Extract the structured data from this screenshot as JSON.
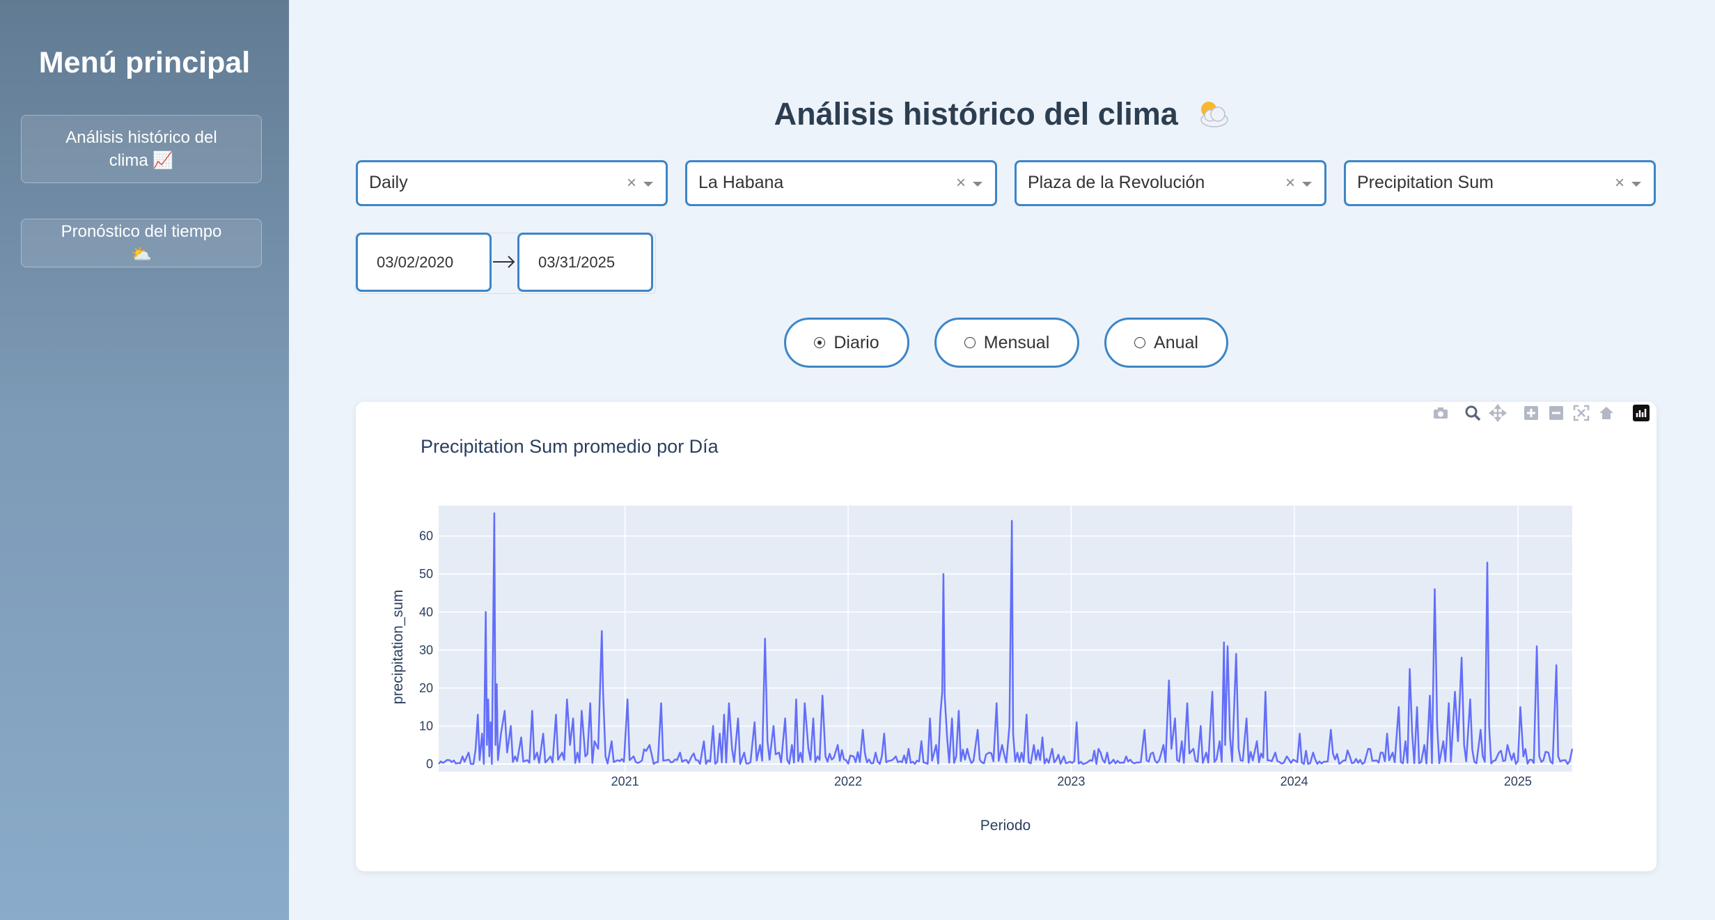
{
  "sidebar": {
    "title": "Menú principal",
    "items": [
      {
        "label": "Análisis histórico del clima",
        "icon": "📈"
      },
      {
        "label": "Pronóstico del tiempo",
        "icon": "⛅"
      }
    ]
  },
  "header": {
    "title": "Análisis histórico del clima",
    "icon": "sun-behind-cloud-icon"
  },
  "filters": {
    "frequency": "Daily",
    "province": "La Habana",
    "municipality": "Plaza de la Revolución",
    "variable": "Precipitation Sum",
    "clear_symbol": "×"
  },
  "date_range": {
    "start": "03/02/2020",
    "end": "03/31/2025"
  },
  "aggregation": {
    "options": [
      "Diario",
      "Mensual",
      "Anual"
    ],
    "selected": "Diario"
  },
  "modebar": [
    "camera-icon",
    "zoom-icon",
    "pan-icon",
    "zoom-in-icon",
    "zoom-out-icon",
    "autoscale-icon",
    "reset-axes-icon",
    "plotly-logo-icon"
  ],
  "colors": {
    "accent": "#3d85c6",
    "series": "#636efa",
    "plot_bg": "#e5ecf6"
  },
  "chart_data": {
    "type": "line",
    "title": "Precipitation Sum promedio por Día",
    "xlabel": "Periodo",
    "ylabel": "precipitation_sum",
    "xlim": [
      "2020-03-02",
      "2025-03-31"
    ],
    "ylim": [
      0,
      68
    ],
    "xticks": [
      "2021",
      "2022",
      "2023",
      "2024",
      "2025"
    ],
    "yticks": [
      0,
      10,
      20,
      30,
      40,
      50,
      60
    ],
    "grid": true,
    "series": [
      {
        "points": [
          [
            "2020-03-02",
            0
          ],
          [
            "2020-03-20",
            1
          ],
          [
            "2020-04-10",
            2
          ],
          [
            "2020-04-20",
            3
          ],
          [
            "2020-04-28",
            0
          ],
          [
            "2020-05-05",
            13
          ],
          [
            "2020-05-08",
            1
          ],
          [
            "2020-05-12",
            8
          ],
          [
            "2020-05-15",
            0
          ],
          [
            "2020-05-18",
            40
          ],
          [
            "2020-05-20",
            5
          ],
          [
            "2020-05-22",
            17
          ],
          [
            "2020-05-24",
            2
          ],
          [
            "2020-05-26",
            11
          ],
          [
            "2020-05-28",
            0
          ],
          [
            "2020-06-01",
            66
          ],
          [
            "2020-06-03",
            5
          ],
          [
            "2020-06-05",
            21
          ],
          [
            "2020-06-07",
            1
          ],
          [
            "2020-06-12",
            8
          ],
          [
            "2020-06-18",
            14
          ],
          [
            "2020-06-22",
            3
          ],
          [
            "2020-06-28",
            10
          ],
          [
            "2020-07-05",
            2
          ],
          [
            "2020-07-15",
            7
          ],
          [
            "2020-07-25",
            1
          ],
          [
            "2020-08-02",
            14
          ],
          [
            "2020-08-10",
            3
          ],
          [
            "2020-08-20",
            8
          ],
          [
            "2020-09-01",
            2
          ],
          [
            "2020-09-10",
            13
          ],
          [
            "2020-09-20",
            3
          ],
          [
            "2020-09-28",
            17
          ],
          [
            "2020-10-03",
            5
          ],
          [
            "2020-10-08",
            12
          ],
          [
            "2020-10-15",
            3
          ],
          [
            "2020-10-22",
            14
          ],
          [
            "2020-10-28",
            2
          ],
          [
            "2020-11-05",
            16
          ],
          [
            "2020-11-12",
            6
          ],
          [
            "2020-11-18",
            4
          ],
          [
            "2020-11-24",
            35
          ],
          [
            "2020-11-26",
            19
          ],
          [
            "2020-11-30",
            2
          ],
          [
            "2020-12-10",
            6
          ],
          [
            "2020-12-20",
            1
          ],
          [
            "2021-01-05",
            17
          ],
          [
            "2021-01-15",
            2
          ],
          [
            "2021-02-10",
            5
          ],
          [
            "2021-03-01",
            16
          ],
          [
            "2021-03-10",
            1
          ],
          [
            "2021-04-01",
            3
          ],
          [
            "2021-04-20",
            2
          ],
          [
            "2021-05-10",
            6
          ],
          [
            "2021-05-25",
            10
          ],
          [
            "2021-06-05",
            8
          ],
          [
            "2021-06-12",
            13
          ],
          [
            "2021-06-20",
            16
          ],
          [
            "2021-06-25",
            4
          ],
          [
            "2021-07-05",
            12
          ],
          [
            "2021-07-15",
            3
          ],
          [
            "2021-08-01",
            11
          ],
          [
            "2021-08-10",
            5
          ],
          [
            "2021-08-18",
            33
          ],
          [
            "2021-08-22",
            6
          ],
          [
            "2021-09-01",
            10
          ],
          [
            "2021-09-10",
            3
          ],
          [
            "2021-09-20",
            12
          ],
          [
            "2021-10-01",
            5
          ],
          [
            "2021-10-08",
            17
          ],
          [
            "2021-10-15",
            3
          ],
          [
            "2021-10-22",
            16
          ],
          [
            "2021-10-28",
            4
          ],
          [
            "2021-11-05",
            12
          ],
          [
            "2021-11-12",
            2
          ],
          [
            "2021-11-20",
            18
          ],
          [
            "2021-11-25",
            2
          ],
          [
            "2021-12-15",
            5
          ],
          [
            "2022-01-10",
            2
          ],
          [
            "2022-01-25",
            9
          ],
          [
            "2022-02-15",
            3
          ],
          [
            "2022-03-01",
            8
          ],
          [
            "2022-03-20",
            2
          ],
          [
            "2022-04-10",
            4
          ],
          [
            "2022-05-01",
            6
          ],
          [
            "2022-05-15",
            12
          ],
          [
            "2022-05-25",
            5
          ],
          [
            "2022-06-01",
            13
          ],
          [
            "2022-06-04",
            19
          ],
          [
            "2022-06-06",
            50
          ],
          [
            "2022-06-08",
            18
          ],
          [
            "2022-06-12",
            7
          ],
          [
            "2022-06-20",
            12
          ],
          [
            "2022-07-01",
            14
          ],
          [
            "2022-07-15",
            4
          ],
          [
            "2022-08-01",
            9
          ],
          [
            "2022-08-20",
            3
          ],
          [
            "2022-09-01",
            16
          ],
          [
            "2022-09-10",
            5
          ],
          [
            "2022-09-22",
            10
          ],
          [
            "2022-09-26",
            64
          ],
          [
            "2022-09-28",
            8
          ],
          [
            "2022-10-05",
            3
          ],
          [
            "2022-10-20",
            13
          ],
          [
            "2022-11-01",
            5
          ],
          [
            "2022-11-15",
            7
          ],
          [
            "2022-12-01",
            4
          ],
          [
            "2022-12-20",
            2
          ],
          [
            "2023-01-10",
            11
          ],
          [
            "2023-02-01",
            1
          ],
          [
            "2023-03-01",
            3
          ],
          [
            "2023-04-01",
            2
          ],
          [
            "2023-05-01",
            9
          ],
          [
            "2023-05-15",
            3
          ],
          [
            "2023-06-01",
            5
          ],
          [
            "2023-06-10",
            22
          ],
          [
            "2023-06-14",
            4
          ],
          [
            "2023-06-20",
            12
          ],
          [
            "2023-07-01",
            6
          ],
          [
            "2023-07-10",
            16
          ],
          [
            "2023-07-20",
            4
          ],
          [
            "2023-08-01",
            10
          ],
          [
            "2023-08-10",
            3
          ],
          [
            "2023-08-20",
            19
          ],
          [
            "2023-09-01",
            6
          ],
          [
            "2023-09-08",
            32
          ],
          [
            "2023-09-10",
            5
          ],
          [
            "2023-09-14",
            31
          ],
          [
            "2023-09-18",
            7
          ],
          [
            "2023-09-28",
            29
          ],
          [
            "2023-10-02",
            4
          ],
          [
            "2023-10-15",
            12
          ],
          [
            "2023-11-01",
            6
          ],
          [
            "2023-11-15",
            19
          ],
          [
            "2023-12-01",
            3
          ],
          [
            "2023-12-20",
            2
          ],
          [
            "2024-01-10",
            8
          ],
          [
            "2024-02-01",
            3
          ],
          [
            "2024-03-01",
            9
          ],
          [
            "2024-04-01",
            2
          ],
          [
            "2024-05-01",
            4
          ],
          [
            "2024-06-01",
            8
          ],
          [
            "2024-06-10",
            3
          ],
          [
            "2024-06-20",
            15
          ],
          [
            "2024-07-01",
            6
          ],
          [
            "2024-07-08",
            25
          ],
          [
            "2024-07-12",
            8
          ],
          [
            "2024-07-20",
            15
          ],
          [
            "2024-08-01",
            5
          ],
          [
            "2024-08-10",
            18
          ],
          [
            "2024-08-18",
            46
          ],
          [
            "2024-08-22",
            10
          ],
          [
            "2024-09-01",
            6
          ],
          [
            "2024-09-10",
            16
          ],
          [
            "2024-09-20",
            19
          ],
          [
            "2024-09-25",
            6
          ],
          [
            "2024-10-01",
            28
          ],
          [
            "2024-10-05",
            5
          ],
          [
            "2024-10-15",
            17
          ],
          [
            "2024-11-01",
            9
          ],
          [
            "2024-11-12",
            53
          ],
          [
            "2024-11-15",
            10
          ],
          [
            "2024-12-01",
            3
          ],
          [
            "2024-12-15",
            5
          ],
          [
            "2025-01-05",
            15
          ],
          [
            "2025-01-10",
            2
          ],
          [
            "2025-02-01",
            31
          ],
          [
            "2025-02-05",
            2
          ],
          [
            "2025-02-20",
            3
          ],
          [
            "2025-03-05",
            26
          ],
          [
            "2025-03-08",
            2
          ],
          [
            "2025-03-20",
            1
          ],
          [
            "2025-03-31",
            4
          ]
        ]
      }
    ]
  }
}
